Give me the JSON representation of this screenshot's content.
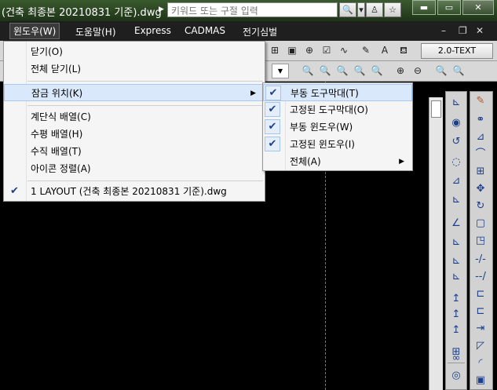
{
  "titlebar": {
    "doc_title": "(건축 최종본 20210831 기준).dwg",
    "search_placeholder": "키워드 또는 구절 입력",
    "icons": [
      "search-icon",
      "dropdown-icon",
      "user-icon",
      "star-icon"
    ]
  },
  "menubar": {
    "items": [
      "윈도우(W)",
      "도움말(H)",
      "Express",
      "CADMAS",
      "전기심벌"
    ],
    "controls": [
      "–",
      "❐",
      "✕"
    ]
  },
  "toolbar": {
    "text_style": "2.0-TEXT"
  },
  "window_menu": {
    "items": [
      {
        "label": "닫기(O)"
      },
      {
        "label": "전체 닫기(L)"
      },
      {
        "label": "잠금 위치(K)",
        "has_submenu": true
      },
      {
        "label": "계단식 배열(C)"
      },
      {
        "label": "수평 배열(H)"
      },
      {
        "label": "수직 배열(T)"
      },
      {
        "label": "아이콘 정렬(A)"
      },
      {
        "label": "1 LAYOUT (건축 최종본 20210831 기준).dwg",
        "checked": true
      }
    ]
  },
  "lock_submenu": {
    "items": [
      {
        "label": "부동 도구막대(T)",
        "checked": true
      },
      {
        "label": "고정된 도구막대(O)",
        "checked": true
      },
      {
        "label": "부동 윈도우(W)",
        "checked": true
      },
      {
        "label": "고정된 윈도우(I)",
        "checked": true
      },
      {
        "label": "전체(A)",
        "has_submenu": true
      }
    ]
  },
  "colors": {
    "title_bar": "#2a4323",
    "menu_highlight": "#d9e8fb",
    "drawing_bg": "#000000"
  }
}
